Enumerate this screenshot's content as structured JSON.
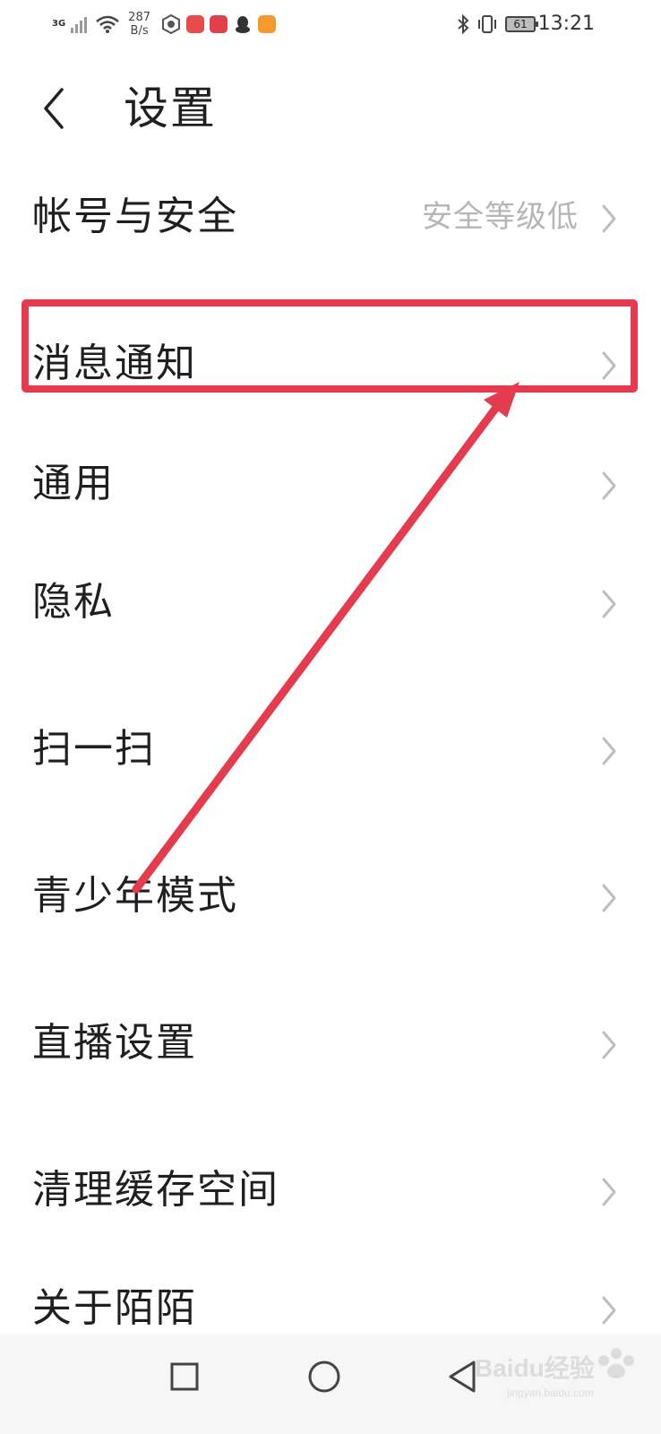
{
  "status_bar": {
    "signal_label": "3G",
    "net_speed_value": "287",
    "net_speed_unit": "B/s",
    "battery_level": "61",
    "time": "13:21"
  },
  "header": {
    "title": "设置"
  },
  "settings": {
    "items": [
      {
        "label": "帐号与安全",
        "value": "安全等级低"
      },
      {
        "label": "消息通知",
        "value": ""
      },
      {
        "label": "通用",
        "value": ""
      },
      {
        "label": "隐私",
        "value": ""
      },
      {
        "label": "扫一扫",
        "value": ""
      },
      {
        "label": "青少年模式",
        "value": ""
      },
      {
        "label": "直播设置",
        "value": ""
      },
      {
        "label": "清理缓存空间",
        "value": ""
      },
      {
        "label": "关于陌陌",
        "value": ""
      }
    ]
  },
  "annotation": {
    "color": "#e43b4f"
  },
  "watermark": {
    "text": "Baidu经验",
    "sub": "jingyan.baidu.com"
  }
}
